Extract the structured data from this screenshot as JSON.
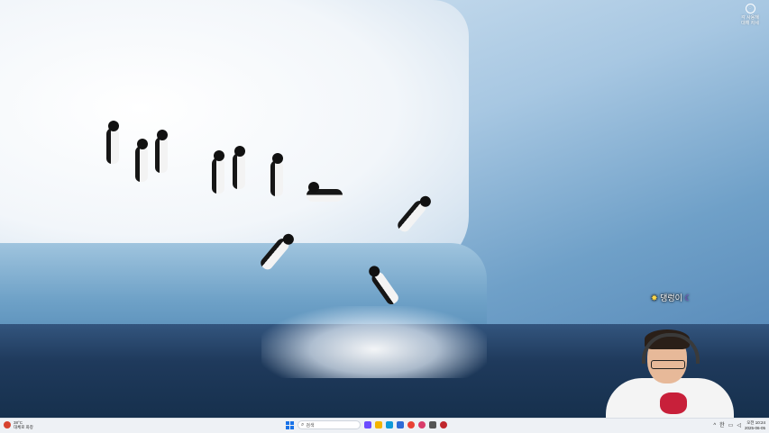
{
  "desktop": {
    "wallpaper": "penguins on iceberg",
    "top_widget": {
      "icon": "power-ring-icon",
      "line1": "각 사용해",
      "line2": "대해 자세"
    }
  },
  "overlay": {
    "text": "댕렁이",
    "star_icon": "star-icon",
    "moon_icon": "moon-icon"
  },
  "taskbar": {
    "weather": {
      "icon": "sun-icon",
      "temp": "38°C",
      "desc": "대체로 화창"
    },
    "search": {
      "placeholder": "검색",
      "icon": "search-icon"
    },
    "pinned": [
      {
        "name": "ai-app-icon",
        "color": "#6c4cff"
      },
      {
        "name": "file-explorer-icon",
        "color": "#f4b400"
      },
      {
        "name": "edge-icon",
        "color": "#0f9ad8"
      },
      {
        "name": "store-icon",
        "color": "#2e6bd6"
      },
      {
        "name": "chrome-icon",
        "color": "#e94235"
      },
      {
        "name": "video-icon",
        "color": "#d93c6a"
      },
      {
        "name": "game-icon",
        "color": "#555555"
      },
      {
        "name": "app-icon",
        "color": "#c0272d"
      }
    ],
    "tray": {
      "chevron": "^",
      "lang": "한",
      "clock_time": "오전 10:24",
      "clock_date": "2025-06-05"
    }
  },
  "colors": {
    "taskbar_bg": "#eef1f5",
    "accent": "#1a73e8"
  }
}
